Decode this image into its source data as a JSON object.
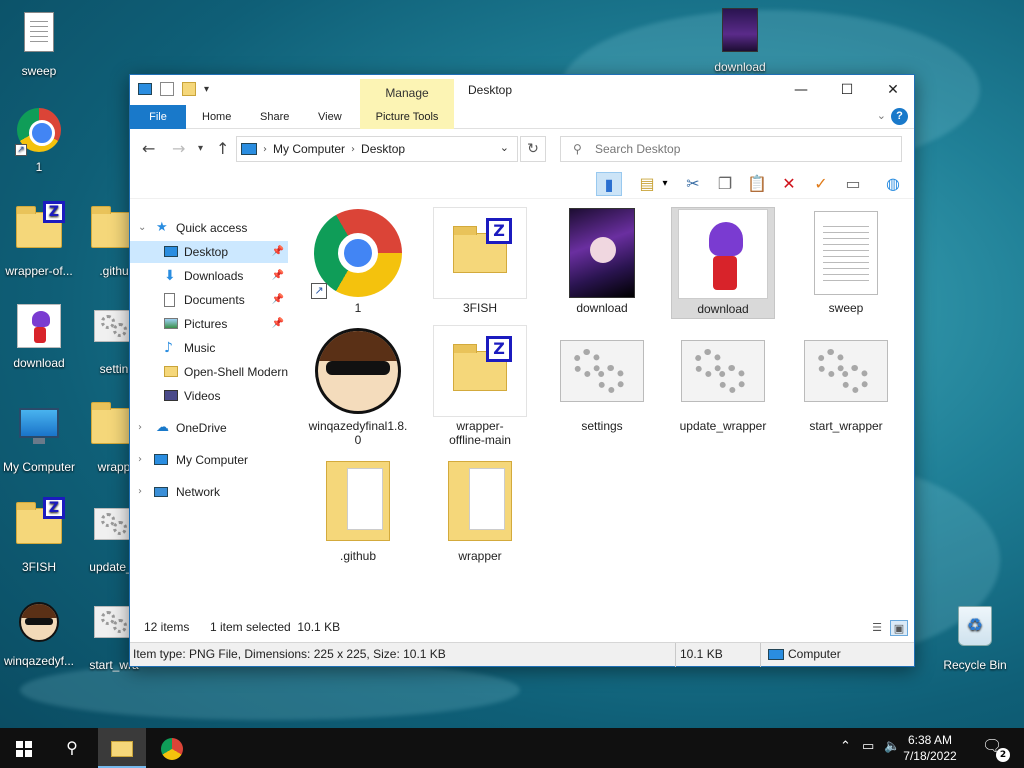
{
  "desktop": {
    "icons": [
      {
        "label": "sweep",
        "type": "doc"
      },
      {
        "label": "1",
        "type": "chrome"
      },
      {
        "label": "wrapper-of...",
        "type": "zfolder"
      },
      {
        "label": ".githu",
        "type": "folder"
      },
      {
        "label": "download",
        "type": "pic-white"
      },
      {
        "label": "settin",
        "type": "gears"
      },
      {
        "label": "My Computer",
        "type": "monitor"
      },
      {
        "label": "wrapp",
        "type": "folder"
      },
      {
        "label": "3FISH",
        "type": "zfolder"
      },
      {
        "label": "update_v",
        "type": "gears"
      },
      {
        "label": "winqazedyf...",
        "type": "face"
      },
      {
        "label": "start_wra",
        "type": "gears"
      },
      {
        "label": "download",
        "type": "pic-purple"
      },
      {
        "label": "Recycle Bin",
        "type": "recycle"
      }
    ]
  },
  "window": {
    "title": "Desktop",
    "manage_label": "Manage",
    "minimize_glyph": "—",
    "maximize_glyph": "☐",
    "close_glyph": "✕",
    "ribbon_tabs": [
      "File",
      "Home",
      "Share",
      "View",
      "Picture Tools"
    ],
    "help_glyph": "?",
    "address": {
      "root": "My Computer",
      "current": "Desktop"
    },
    "search_placeholder": "Search Desktop"
  },
  "sidebar": {
    "items": [
      {
        "label": "Quick access",
        "icon": "star-icon"
      },
      {
        "label": "Desktop",
        "icon": "desktop-icon",
        "pinned": true,
        "selected": true
      },
      {
        "label": "Downloads",
        "icon": "download-arrow-icon",
        "pinned": true
      },
      {
        "label": "Documents",
        "icon": "documents-icon",
        "pinned": true
      },
      {
        "label": "Pictures",
        "icon": "pictures-icon",
        "pinned": true
      },
      {
        "label": "Music",
        "icon": "music-note-icon"
      },
      {
        "label": "Open-Shell Modern",
        "icon": "folder-icon"
      },
      {
        "label": "Videos",
        "icon": "videos-icon"
      },
      {
        "label": "OneDrive",
        "icon": "cloud-icon"
      },
      {
        "label": "My Computer",
        "icon": "computer-icon"
      },
      {
        "label": "Network",
        "icon": "network-icon"
      }
    ]
  },
  "files": [
    {
      "label": "1",
      "type": "chrome"
    },
    {
      "label": "3FISH",
      "type": "zfolder"
    },
    {
      "label": "download",
      "type": "purple"
    },
    {
      "label": "download",
      "type": "white",
      "selected": true
    },
    {
      "label": "sweep",
      "type": "doc"
    },
    {
      "label": "winqazedyfinal1.8.0",
      "type": "face"
    },
    {
      "label": "wrapper-offline-main",
      "type": "zfolder"
    },
    {
      "label": "settings",
      "type": "gears"
    },
    {
      "label": "update_wrapper",
      "type": "gears"
    },
    {
      "label": "start_wrapper",
      "type": "gears"
    },
    {
      "label": ".github",
      "type": "folder"
    },
    {
      "label": "wrapper",
      "type": "folder"
    }
  ],
  "status": {
    "item_count": "12 items",
    "selected": "1 item selected  10.1 KB",
    "info": "Item type: PNG File, Dimensions: 225 x 225, Size: 10.1 KB",
    "size": "10.1 KB",
    "location": "Computer"
  },
  "taskbar": {
    "time": "6:38 AM",
    "date": "7/18/2022",
    "notifications": "2"
  }
}
